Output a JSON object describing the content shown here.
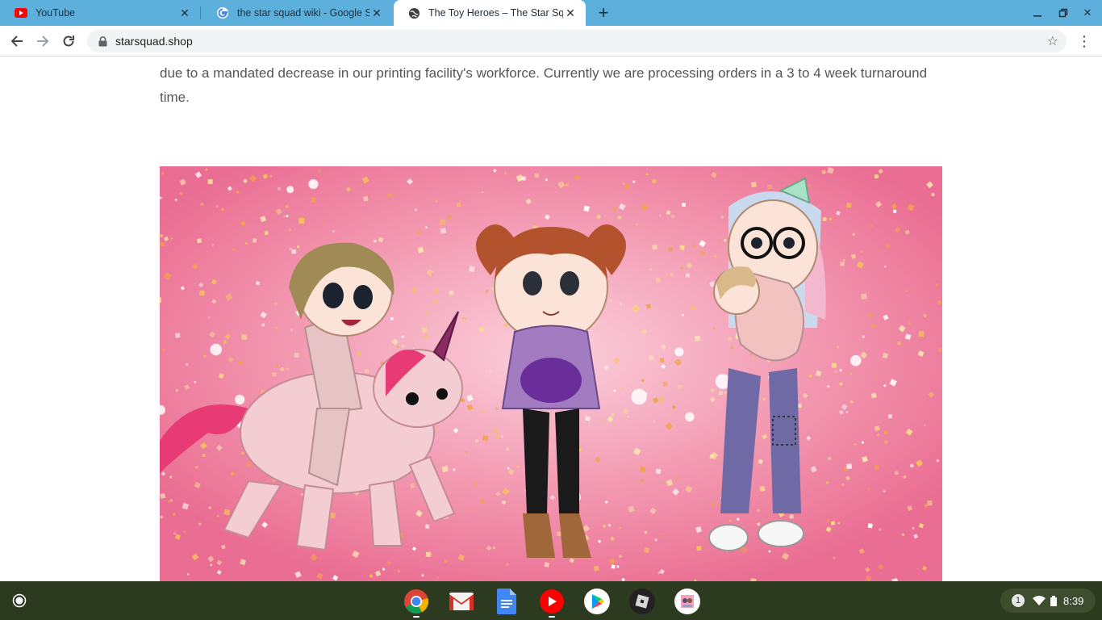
{
  "tabs": [
    {
      "title": "YouTube",
      "icon": "youtube-icon",
      "active": false
    },
    {
      "title": "the star squad wiki - Google Sear",
      "icon": "google-icon",
      "active": false
    },
    {
      "title": "The Toy Heroes – The Star Squa",
      "icon": "globe-icon",
      "active": true
    }
  ],
  "toolbar": {
    "url": "starsquad.shop"
  },
  "page": {
    "notice_text": "due to a mandated decrease in our printing facility's workforce. Currently we are processing orders in a 3 to 4 week turnaround time.",
    "hero_image": "illustration-three-characters-with-toys-on-pink-glitter-background"
  },
  "shelf": {
    "apps": [
      "chrome-icon",
      "gmail-icon",
      "docs-icon",
      "youtube-icon",
      "play-store-icon",
      "roblox-icon",
      "custom-app-icon"
    ],
    "notification_count": "1",
    "time": "8:39"
  },
  "colors": {
    "tabstrip": "#5eb0dc",
    "shelf": "#2c3a1f",
    "hero_pink": "#f190aa"
  }
}
